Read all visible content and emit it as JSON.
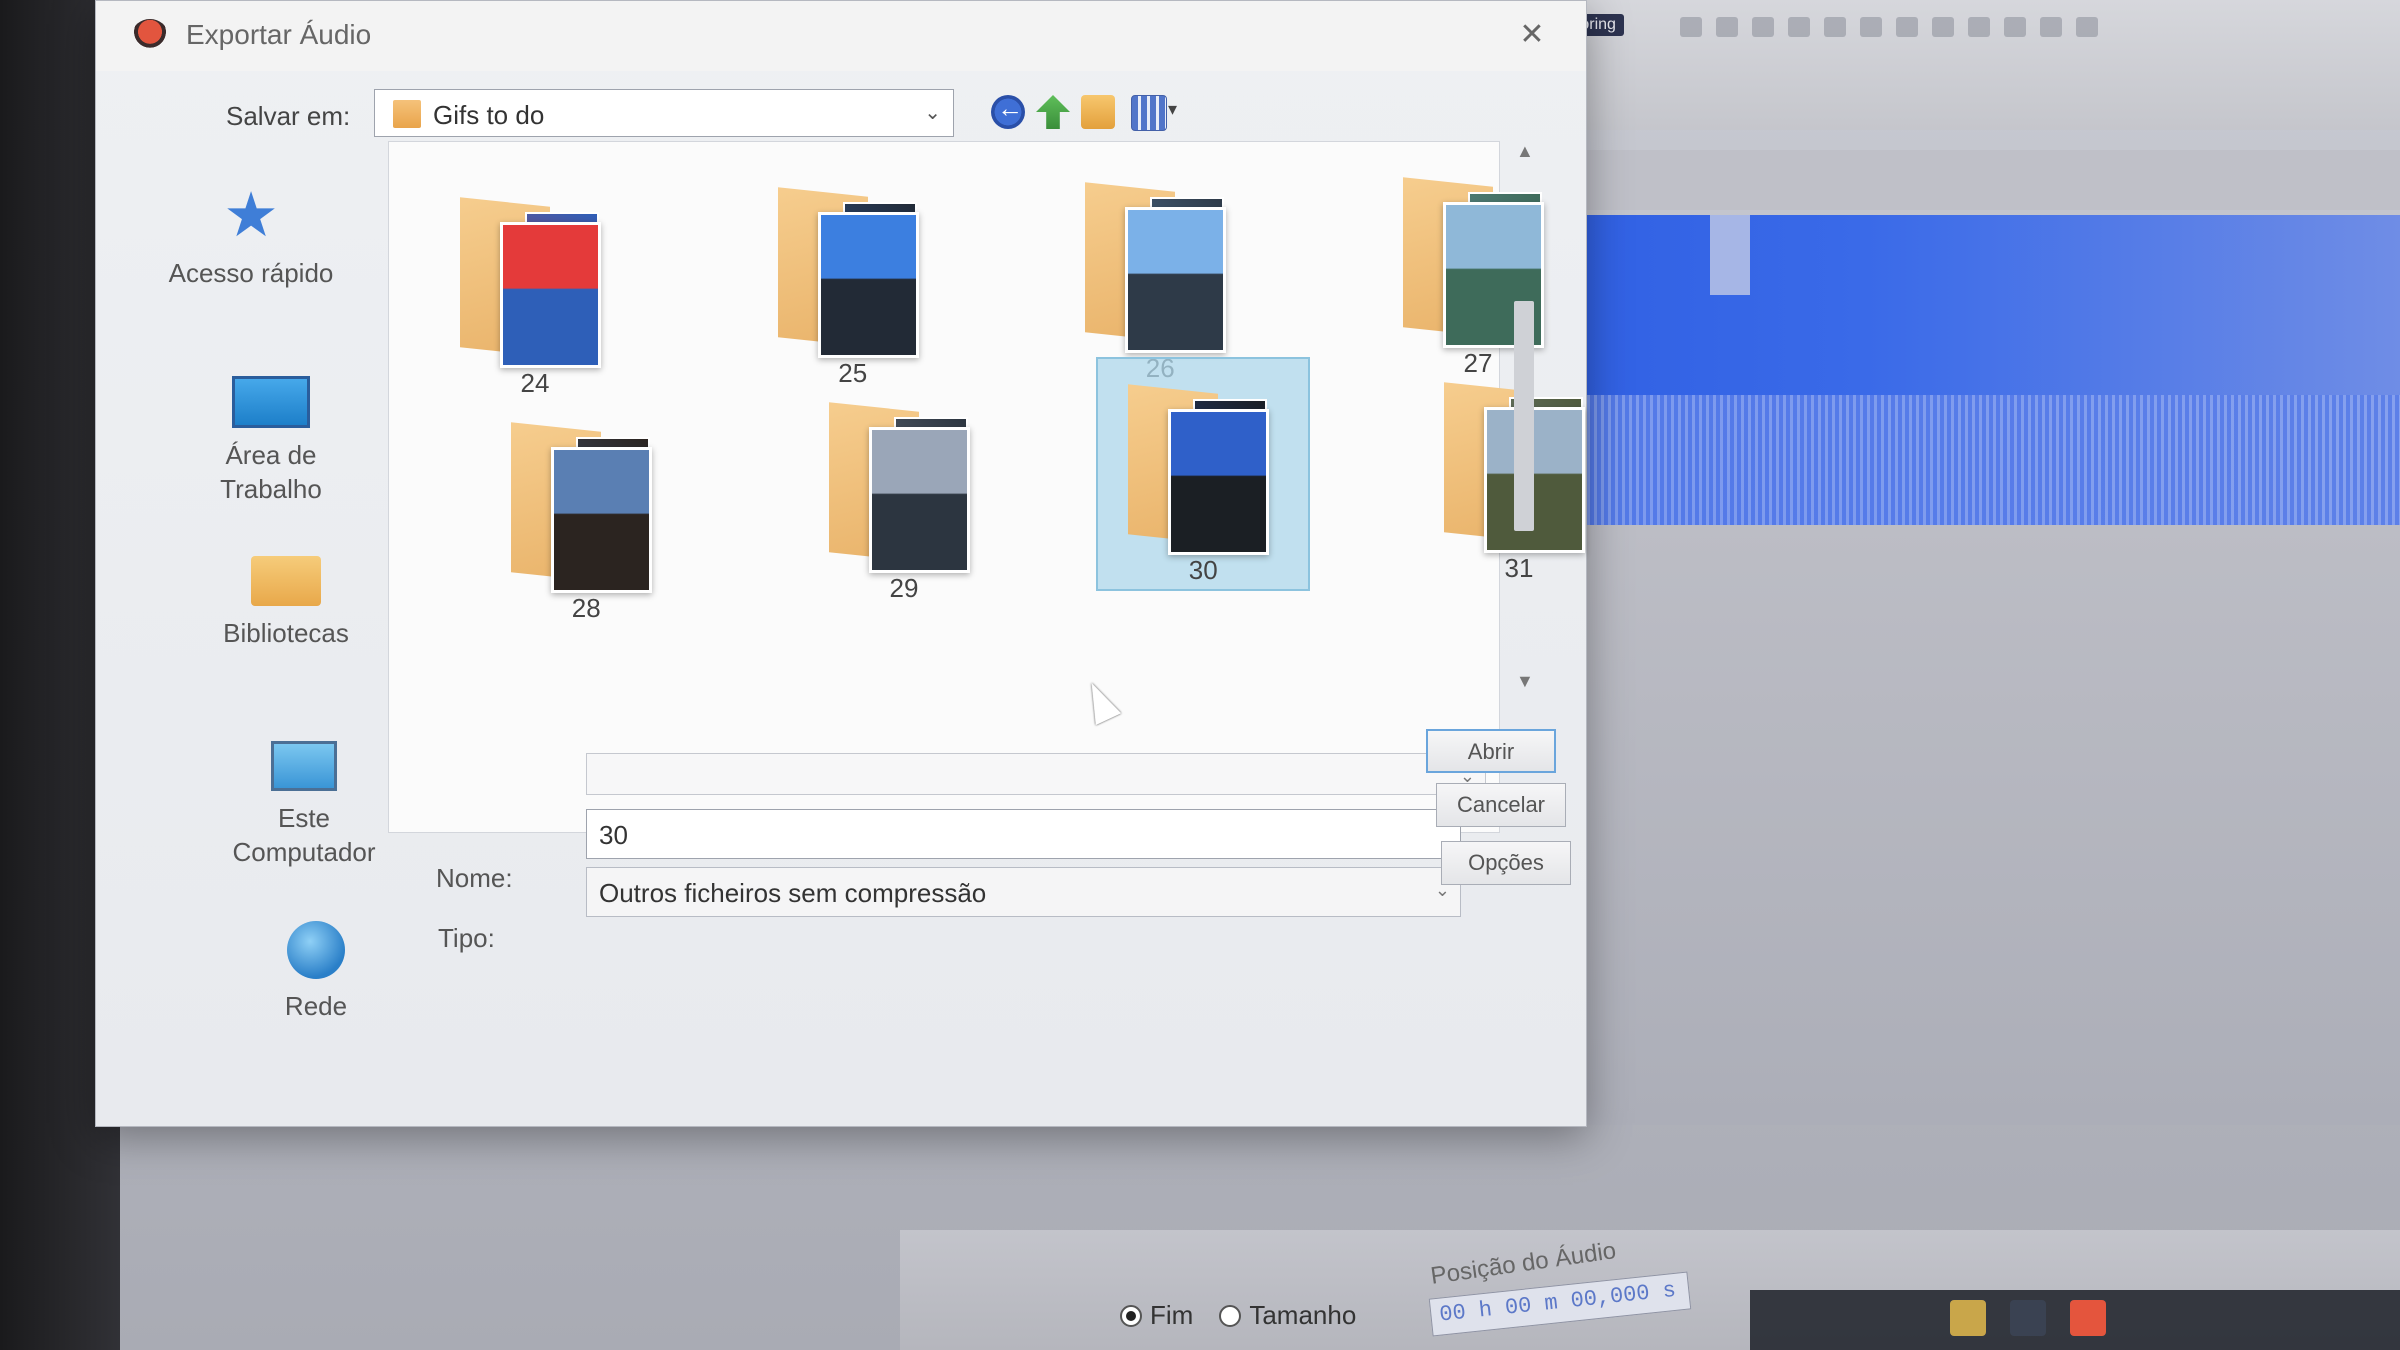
{
  "dialog": {
    "title": "Exportar Áudio",
    "close_glyph": "✕",
    "save_in_label": "Salvar em:",
    "save_in_value": "Gifs to do",
    "chevron": "⌄",
    "view_arrow": "▾"
  },
  "sidebar": {
    "items": [
      {
        "label": "Acesso rápido",
        "icon": "star-icon"
      },
      {
        "label": "Área de Trabalho",
        "icon": "desktop-icon"
      },
      {
        "label": "Bibliotecas",
        "icon": "libraries-icon"
      },
      {
        "label": "Este Computador",
        "icon": "computer-icon"
      },
      {
        "label": "Rede",
        "icon": "network-icon"
      }
    ]
  },
  "files": {
    "folders": [
      {
        "label": "24",
        "colors": [
          "#e43a3a",
          "#2e5fb8"
        ],
        "selected": false
      },
      {
        "label": "25",
        "colors": [
          "#3c7fe0",
          "#222a36"
        ],
        "selected": false
      },
      {
        "label": "26",
        "colors": [
          "#7bb1e8",
          "#2e3a48"
        ],
        "selected": false
      },
      {
        "label": "27",
        "colors": [
          "#8fb8d8",
          "#3e6b5a"
        ],
        "selected": false
      },
      {
        "label": "28",
        "colors": [
          "#5a7fb3",
          "#2b2420"
        ],
        "selected": false
      },
      {
        "label": "29",
        "colors": [
          "#9aa6b8",
          "#2c3540"
        ],
        "selected": false
      },
      {
        "label": "30",
        "colors": [
          "#2f60c9",
          "#1b1f24"
        ],
        "selected": true
      },
      {
        "label": "31",
        "colors": [
          "#9bb2c8",
          "#4f5a3c"
        ],
        "selected": false
      }
    ]
  },
  "form": {
    "name_label": "Nome:",
    "name_value": "30",
    "type_label": "Tipo:",
    "type_value": "Outros ficheiros sem compressão"
  },
  "buttons": {
    "save": "Abrir",
    "cancel": "Cancelar",
    "options": "Opções"
  },
  "editor": {
    "toolbar_label": "Start Monitoring",
    "status": {
      "radio_end": "Fim",
      "radio_length": "Tamanho",
      "audio_position_label": "Posição do Áudio",
      "audio_position_value": "00 h 00 m 00,000 s"
    }
  }
}
